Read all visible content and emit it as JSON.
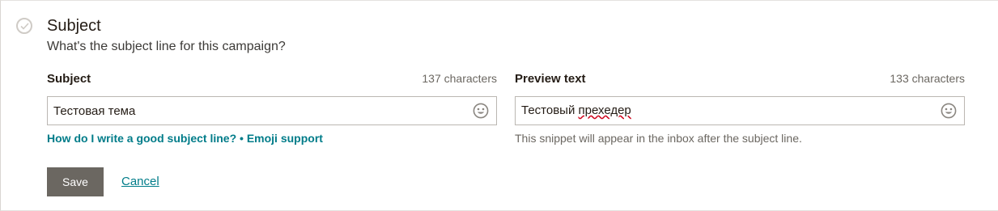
{
  "section": {
    "title": "Subject",
    "subtitle": "What's the subject line for this campaign?"
  },
  "subject_field": {
    "label": "Subject",
    "count": "137 characters",
    "value": "Тестовая тема",
    "help_link_1": "How do I write a good subject line?",
    "separator": "•",
    "help_link_2": "Emoji support"
  },
  "preview_field": {
    "label": "Preview text",
    "count": "133 characters",
    "value_word_1": "Тестовый",
    "value_word_2": "прехедер",
    "help_text": "This snippet will appear in the inbox after the subject line."
  },
  "actions": {
    "save_label": "Save",
    "cancel_label": "Cancel"
  },
  "icons": {
    "status": "checkmark-circle-icon",
    "emoji": "smiley-face-icon"
  },
  "colors": {
    "link": "#007c89",
    "save_button": "#6b6761",
    "text_dark": "#241c15",
    "text_muted": "#6b6761"
  }
}
